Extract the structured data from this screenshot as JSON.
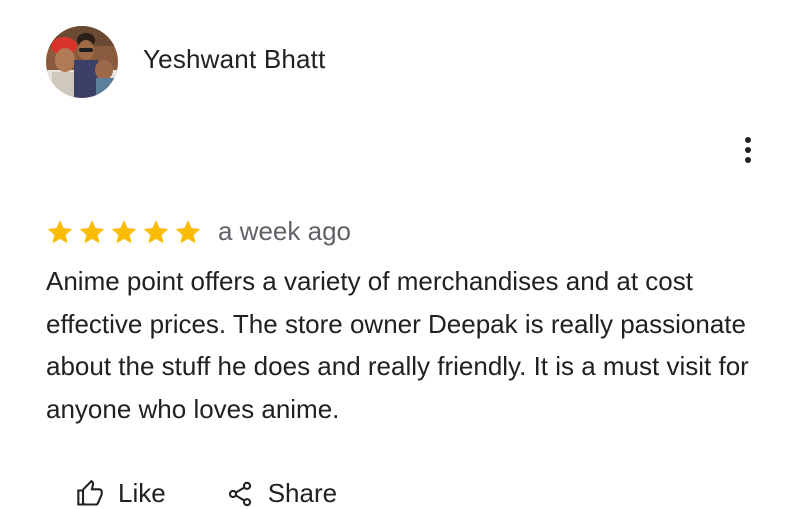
{
  "reviewer": {
    "name": "Yeshwant Bhatt",
    "avatar_icon": "user-photo-avatar"
  },
  "menu": {
    "icon": "more-vert-icon"
  },
  "review": {
    "rating": 5,
    "rating_max": 5,
    "star_color": "#fbbc04",
    "date": "a week ago",
    "text": "Anime point offers a variety of merchandises and at cost effective prices. The store owner Deepak is really passionate about the stuff he does and really friendly. It is a must visit for anyone who loves anime."
  },
  "actions": {
    "like_label": "Like",
    "like_icon": "thumb-up-icon",
    "share_label": "Share",
    "share_icon": "share-icon"
  }
}
